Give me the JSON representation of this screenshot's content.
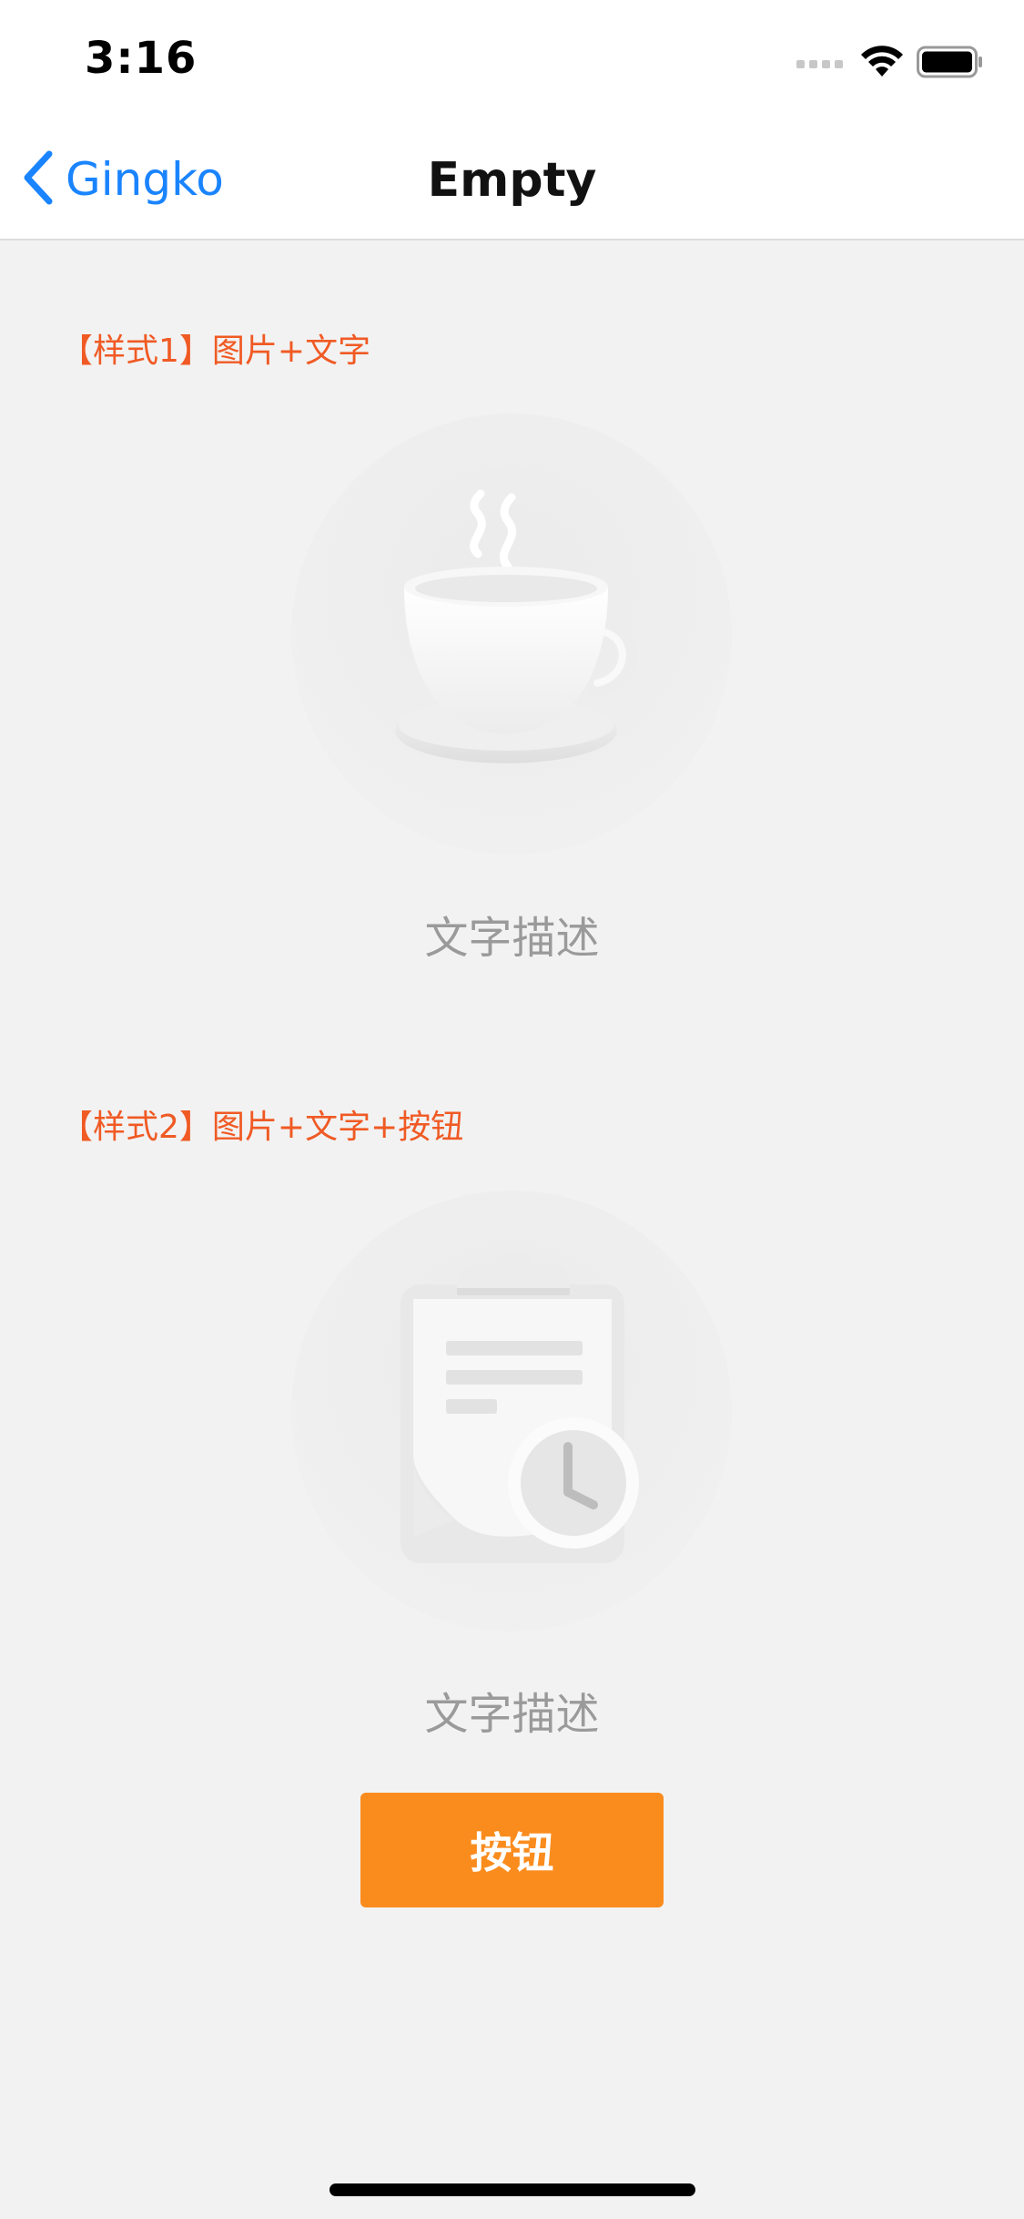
{
  "status_bar": {
    "time": "3:16"
  },
  "nav": {
    "back_label": "Gingko",
    "title": "Empty"
  },
  "section1": {
    "label": "【样式1】图片+文字",
    "description": "文字描述"
  },
  "section2": {
    "label": "【样式2】图片+文字+按钮",
    "description": "文字描述",
    "button_label": "按钮"
  },
  "colors": {
    "accent_blue": "#1a84ff",
    "label_orange_red": "#f05a24",
    "button_orange": "#fa8c1e",
    "description_gray": "#9a9a9a",
    "background": "#f2f2f2"
  },
  "icons": {
    "back": "chevron-left-icon",
    "signal": "cellular-signal-icon",
    "wifi": "wifi-icon",
    "battery": "battery-icon",
    "illustration1": "coffee-cup-icon",
    "illustration2": "clipboard-clock-icon"
  }
}
